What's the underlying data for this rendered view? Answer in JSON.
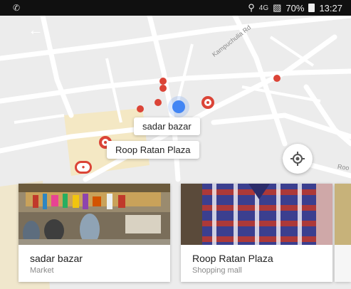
{
  "status_bar": {
    "left_icon": "whatsapp-icon",
    "network": "4G",
    "battery": "70%",
    "time": "13:27"
  },
  "map": {
    "road_labels": [
      "Kampuchulia Rd",
      "Roo"
    ],
    "tooltips": [
      "sadar bazar",
      "Roop Ratan Plaza"
    ],
    "marker_color": "#db4437",
    "location_color": "#4285f4"
  },
  "cards": [
    {
      "title": "sadar bazar",
      "subtitle": "Market"
    },
    {
      "title": "Roop Ratan Plaza",
      "subtitle": "Shopping mall"
    }
  ]
}
